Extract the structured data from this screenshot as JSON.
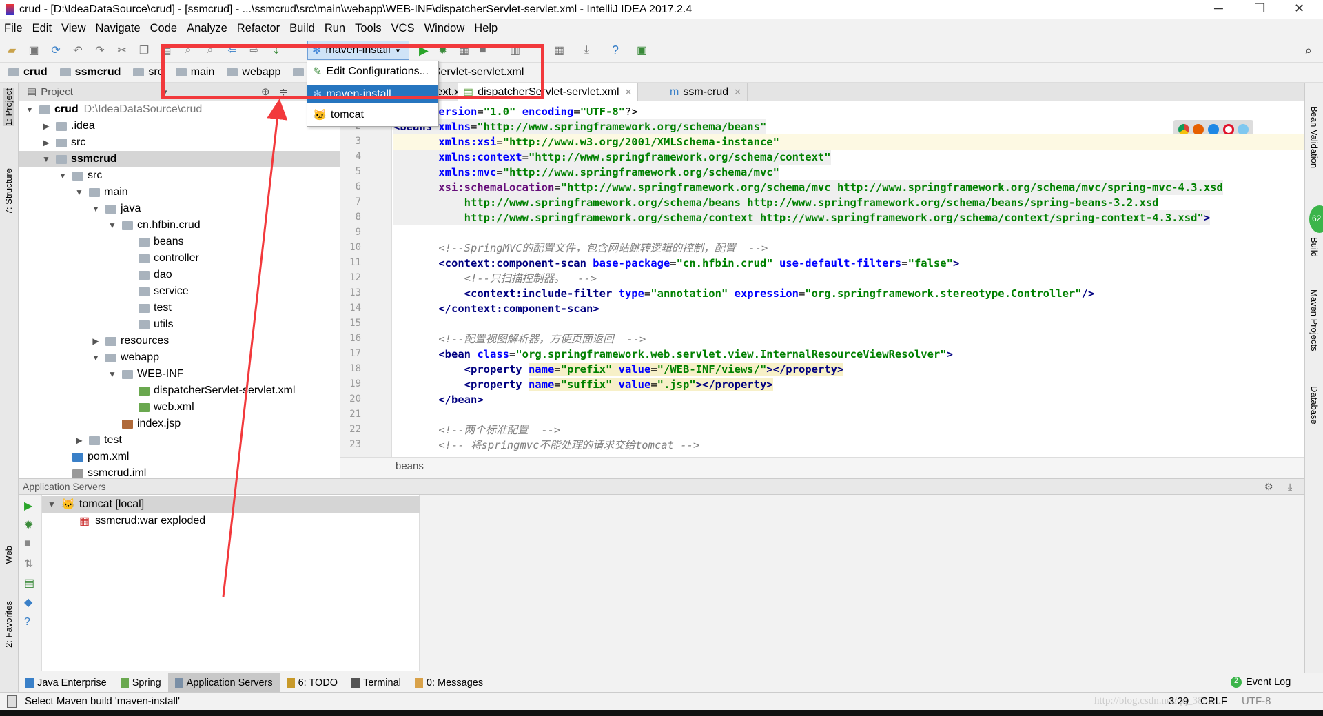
{
  "window": {
    "title": "crud - [D:\\IdeaDataSource\\crud] - [ssmcrud] - ...\\ssmcrud\\src\\main\\webapp\\WEB-INF\\dispatcherServlet-servlet.xml - IntelliJ IDEA 2017.2.4"
  },
  "menu": [
    "File",
    "Edit",
    "View",
    "Navigate",
    "Code",
    "Analyze",
    "Refactor",
    "Build",
    "Run",
    "Tools",
    "VCS",
    "Window",
    "Help"
  ],
  "toolbar": {
    "run_config": "maven-install"
  },
  "breadcrumbs": [
    "crud",
    "ssmcrud",
    "src",
    "main",
    "webapp",
    "WEB-INF",
    "dispatcherServlet-servlet.xml"
  ],
  "run_menu": {
    "items": [
      "Edit Configurations...",
      "maven-install",
      "tomcat"
    ],
    "selected": "maven-install"
  },
  "left_strip": {
    "project": "1: Project",
    "structure": "7: Structure",
    "web": "Web",
    "favorites": "2: Favorites"
  },
  "right_strip": {
    "bean_validation": "Bean Validation",
    "build": "Build",
    "build_badge": "62",
    "maven": "Maven Projects",
    "database": "Database"
  },
  "project_panel": {
    "title": "Project",
    "tree": [
      {
        "label": "crud",
        "extra": "D:\\IdeaDataSource\\crud",
        "depth": 0,
        "arrow": "down",
        "bold": true
      },
      {
        "label": ".idea",
        "depth": 1,
        "arrow": "right"
      },
      {
        "label": "src",
        "depth": 1,
        "arrow": "right"
      },
      {
        "label": "ssmcrud",
        "depth": 1,
        "arrow": "down",
        "bold": true,
        "selected": true
      },
      {
        "label": "src",
        "depth": 2,
        "arrow": "down"
      },
      {
        "label": "main",
        "depth": 3,
        "arrow": "down"
      },
      {
        "label": "java",
        "depth": 4,
        "arrow": "down"
      },
      {
        "label": "cn.hfbin.crud",
        "depth": 5,
        "arrow": "down"
      },
      {
        "label": "beans",
        "depth": 6
      },
      {
        "label": "controller",
        "depth": 6
      },
      {
        "label": "dao",
        "depth": 6
      },
      {
        "label": "service",
        "depth": 6
      },
      {
        "label": "test",
        "depth": 6
      },
      {
        "label": "utils",
        "depth": 6
      },
      {
        "label": "resources",
        "depth": 4,
        "arrow": "right"
      },
      {
        "label": "webapp",
        "depth": 4,
        "arrow": "down"
      },
      {
        "label": "WEB-INF",
        "depth": 5,
        "arrow": "down"
      },
      {
        "label": "dispatcherServlet-servlet.xml",
        "depth": 6,
        "icon": "xml"
      },
      {
        "label": "web.xml",
        "depth": 6,
        "icon": "xml"
      },
      {
        "label": "index.jsp",
        "depth": 5,
        "icon": "jsp"
      },
      {
        "label": "test",
        "depth": 3,
        "arrow": "right"
      },
      {
        "label": "pom.xml",
        "depth": 2,
        "icon": "maven"
      },
      {
        "label": "ssmcrud.iml",
        "depth": 2,
        "icon": "file"
      }
    ]
  },
  "editor": {
    "tabs": [
      {
        "label": "applicationContext.xml",
        "active": false
      },
      {
        "label": "dispatcherServlet-servlet.xml",
        "active": true
      },
      {
        "label": "ssm-crud",
        "active": false
      }
    ],
    "footer_crumb": "beans",
    "lines": [
      [
        [
          "p",
          "<?xml "
        ],
        [
          "a",
          "version"
        ],
        [
          "p",
          "="
        ],
        [
          "v",
          "\"1.0\""
        ],
        [
          "p",
          " "
        ],
        [
          "a",
          "encoding"
        ],
        [
          "p",
          "="
        ],
        [
          "v",
          "\"UTF-8\""
        ],
        [
          "p",
          "?>"
        ]
      ],
      [
        [
          "t",
          "<beans "
        ],
        [
          "a",
          "xmlns"
        ],
        [
          "p",
          "="
        ],
        [
          "v",
          "\"http://www.springframework.org/schema/beans\""
        ]
      ],
      [
        [
          "p",
          "       "
        ],
        [
          "a",
          "xmlns:xsi"
        ],
        [
          "p",
          "="
        ],
        [
          "v",
          "\"http://www.w3.org/2001/XMLSchema-instance\""
        ]
      ],
      [
        [
          "p",
          "       "
        ],
        [
          "a",
          "xmlns:context"
        ],
        [
          "p",
          "="
        ],
        [
          "v",
          "\"http://www.springframework.org/schema/context\""
        ]
      ],
      [
        [
          "p",
          "       "
        ],
        [
          "a",
          "xmlns:mvc"
        ],
        [
          "p",
          "="
        ],
        [
          "v",
          "\"http://www.springframework.org/schema/mvc\""
        ]
      ],
      [
        [
          "p",
          "       "
        ],
        [
          "n",
          "xsi:schemaLocation"
        ],
        [
          "p",
          "="
        ],
        [
          "v",
          "\"http://www.springframework.org/schema/mvc http://www.springframework.org/schema/mvc/spring-mvc-4.3.xsd"
        ]
      ],
      [
        [
          "v",
          "           http://www.springframework.org/schema/beans http://www.springframework.org/schema/beans/spring-beans-3.2.xsd"
        ]
      ],
      [
        [
          "v",
          "           http://www.springframework.org/schema/context http://www.springframework.org/schema/context/spring-context-4.3.xsd\""
        ],
        [
          "t",
          ">"
        ]
      ],
      [],
      [
        [
          "c",
          "       <!--SpringMVC的配置文件，包含网站跳转逻辑的控制，配置  -->"
        ]
      ],
      [
        [
          "t",
          "       <context:component-scan "
        ],
        [
          "a",
          "base-package"
        ],
        [
          "p",
          "="
        ],
        [
          "v",
          "\"cn.hfbin.crud\""
        ],
        [
          "p",
          " "
        ],
        [
          "a",
          "use-default-filters"
        ],
        [
          "p",
          "="
        ],
        [
          "v",
          "\"false\""
        ],
        [
          "t",
          ">"
        ]
      ],
      [
        [
          "c",
          "           <!--只扫描控制器。  -->"
        ]
      ],
      [
        [
          "t",
          "           <context:include-filter "
        ],
        [
          "a",
          "type"
        ],
        [
          "p",
          "="
        ],
        [
          "v",
          "\"annotation\""
        ],
        [
          "p",
          " "
        ],
        [
          "a",
          "expression"
        ],
        [
          "p",
          "="
        ],
        [
          "v",
          "\"org.springframework.stereotype.Controller\""
        ],
        [
          "t",
          "/>"
        ]
      ],
      [
        [
          "t",
          "       </context:component-scan>"
        ]
      ],
      [],
      [
        [
          "c",
          "       <!--配置视图解析器，方便页面返回  -->"
        ]
      ],
      [
        [
          "t",
          "       <bean "
        ],
        [
          "a",
          "class"
        ],
        [
          "p",
          "="
        ],
        [
          "v",
          "\"org.springframework.web.servlet.view.InternalResourceViewResolver\""
        ],
        [
          "t",
          ">"
        ]
      ],
      [
        [
          "t",
          "           <property "
        ],
        [
          "a",
          "name"
        ],
        [
          "p",
          "="
        ],
        [
          "v",
          "\"prefix\""
        ],
        [
          "p",
          " "
        ],
        [
          "a",
          "value"
        ],
        [
          "p",
          "="
        ],
        [
          "v",
          "\"/WEB-INF/views/\""
        ],
        [
          "t",
          "></property>"
        ]
      ],
      [
        [
          "t",
          "           <property "
        ],
        [
          "a",
          "name"
        ],
        [
          "p",
          "="
        ],
        [
          "v",
          "\"suffix\""
        ],
        [
          "p",
          " "
        ],
        [
          "a",
          "value"
        ],
        [
          "p",
          "="
        ],
        [
          "v",
          "\".jsp\""
        ],
        [
          "t",
          "></property>"
        ]
      ],
      [
        [
          "t",
          "       </bean>"
        ]
      ],
      [],
      [
        [
          "c",
          "       <!--两个标准配置  -->"
        ]
      ],
      [
        [
          "c",
          "       <!-- 将springmvc不能处理的请求交给tomcat -->"
        ]
      ]
    ]
  },
  "app_servers": {
    "title": "Application Servers",
    "items": [
      {
        "label": "tomcat [local]",
        "expanded": true
      },
      {
        "label": "ssmcrud:war exploded"
      }
    ]
  },
  "bottom_tabs": [
    "Java Enterprise",
    "Spring",
    "Application Servers",
    "6: TODO",
    "Terminal",
    "0: Messages"
  ],
  "bottom_active": "Application Servers",
  "event_log": {
    "label": "Event Log",
    "count": "2"
  },
  "status": {
    "message": "Select Maven build 'maven-install'",
    "position": "3:29",
    "line_sep": "CRLF",
    "encoding": "UTF-8",
    "watermark": "http://blog.csdn.net/qq_3852..."
  },
  "colors": {
    "highlight_box": "#f2393c",
    "selection": "#2675bf"
  }
}
